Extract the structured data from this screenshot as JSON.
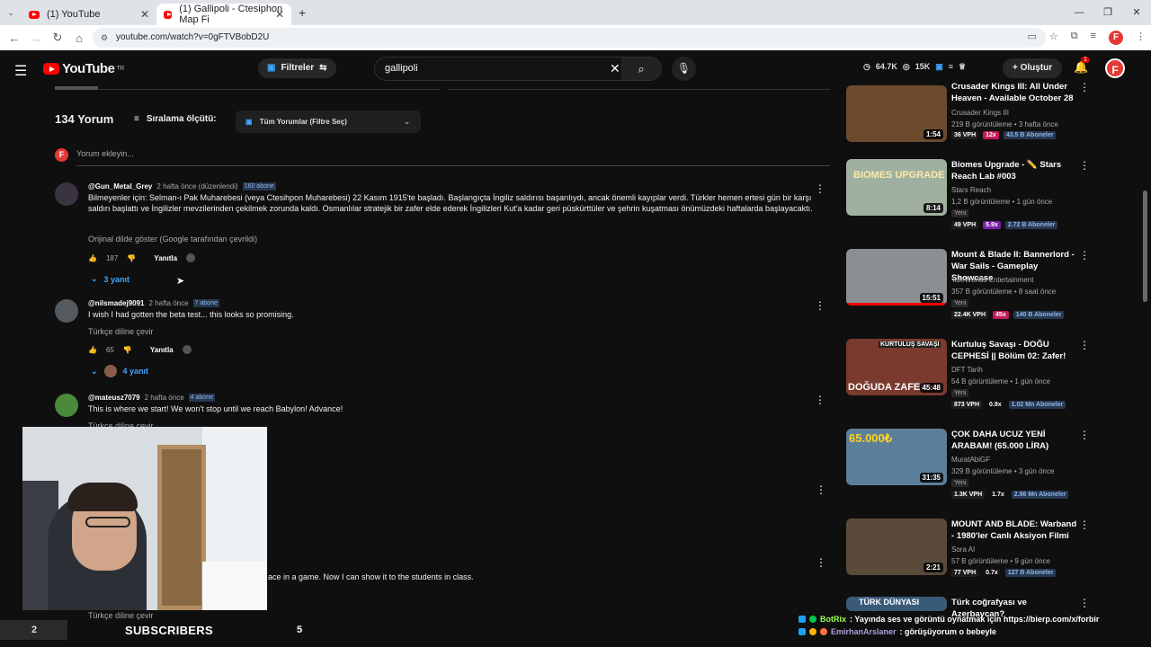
{
  "browser": {
    "tabs": [
      {
        "label": "(1) YouTube"
      },
      {
        "label": "(1) Gallipoli - Ctesiphon Map Fi"
      }
    ],
    "url": "youtube.com/watch?v=0gFTVBobD2U",
    "new_tab": "+",
    "window_controls": [
      "—",
      "❐",
      "✕"
    ]
  },
  "masthead": {
    "logo": "YouTube",
    "country": "TR",
    "filters_label": "Filtreler",
    "search_value": "gallipoli",
    "stats": [
      "64.7K",
      "15K"
    ],
    "create_label": "Oluştur",
    "notif_count": "1",
    "avatar_letter": "F"
  },
  "comments_header": {
    "count": "134 Yorum",
    "sort_label": "Sıralama ölçütü:",
    "filter_label": "Tüm Yorumlar (Filtre Seç)",
    "add_placeholder": "Yorum ekleyin..."
  },
  "comments": [
    {
      "user": "@Gun_Metal_Grey",
      "time": "2 hafta önce (düzenlendi)",
      "subs": "160 abone",
      "text": "Bilmeyenler için: Selman-ı Pak Muharebesi (veya Ctesihpon Muharebesi) 22 Kasım 1915'te başladı. Başlangıçta İngiliz saldırısı başarılıydı, ancak önemli kayıplar verdi. Türkler hemen ertesi gün bir karşı saldırı başlattı ve İngilizler mevzilerinden çekilmek zorunda kaldı. Osmanlılar stratejik bir zafer elde ederek İngilizleri Kut'a kadar geri püskürttüler ve şehrin kuşatması önümüzdeki haftalarda başlayacaktı.",
      "translate": "Orijinal dilde göster (Google tarafından çevrildi)",
      "likes": "187",
      "reply_label": "Yanıtla",
      "replies": "3 yanıt"
    },
    {
      "user": "@nilsmadej9091",
      "time": "2 hafta önce",
      "subs": "7 abone",
      "text": "I wish I had gotten the beta test... this looks so promising.",
      "translate": "Türkçe diline çevir",
      "likes": "65",
      "reply_label": "Yanıtla",
      "replies": "4 yanıt"
    },
    {
      "user": "@mateusz7079",
      "time": "2 hafta önce",
      "subs": "4 abone",
      "text": "This is where we start! We won't stop until we reach Babylon! Advance!",
      "translate": "Türkçe diline çevir"
    }
  ],
  "partial_comment": {
    "text": "ace in a game. Now I can show it to the students in class.",
    "translate": "Türkçe diline çevir"
  },
  "sidebar": [
    {
      "title": "Crusader Kings III: All Under Heaven - Available October 28",
      "channel": "Crusader Kings III",
      "meta": "219 B görüntüleme • 3 hafta önce",
      "duration": "1:54",
      "vph": "36 VPH",
      "mult": "12x",
      "subs": "43.5 B Aboneler",
      "thumb_color": "#6b4a2e",
      "mult_color": "#c2185b"
    },
    {
      "title": "Biomes Upgrade - ✏️ Stars Reach Lab #003",
      "channel": "Stars Reach",
      "meta": "1,2 B görüntüleme • 1 gün önce",
      "badge": "Yeni",
      "duration": "8:14",
      "vph": "49 VPH",
      "mult": "5.9x",
      "subs": "2.72 B Aboneler",
      "thumb_label": "BIOMES UPGRADE",
      "thumb_color": "#9fb0a0",
      "mult_color": "#7b1fa2"
    },
    {
      "title": "Mount & Blade II: Bannerlord - War Sails - Gameplay Showcase",
      "channel": "TaleWorlds Entertainment",
      "meta": "357 B görüntüleme • 8 saat önce",
      "badge": "Yeni",
      "duration": "15:51",
      "vph": "22.4K VPH",
      "mult": "45x",
      "subs": "140 B Aboneler",
      "thumb_color": "#8a8f93",
      "mult_color": "#c2185b",
      "progress": 1.0
    },
    {
      "title": "Kurtuluş Savaşı - DOĞU CEPHESİ || Bölüm 02: Zafer!",
      "channel": "DFT Tarih",
      "meta": "54 B görüntüleme • 1 gün önce",
      "badge": "Yeni",
      "duration": "45:48",
      "vph": "873 VPH",
      "mult": "0.9x",
      "subs": "1.02 Mn Aboneler",
      "thumb_label": "KURTULUŞ SAVAŞI",
      "thumb_label2": "DOĞUDA ZAFER",
      "thumb_color": "#7a3a2e",
      "mult_color": ""
    },
    {
      "title": "ÇOK DAHA UCUZ YENİ ARABAM! (65.000 LİRA)",
      "channel": "MuratAbiGF",
      "meta": "329 B görüntüleme • 3 gün önce",
      "badge": "Yeni",
      "duration": "31:35",
      "vph": "1.3K VPH",
      "mult": "1.7x",
      "subs": "2.86 Mn Aboneler",
      "thumb_label": "65.000₺",
      "thumb_color": "#5b7f9a",
      "mult_color": ""
    },
    {
      "title": "MOUNT AND BLADE: Warband - 1980'ler Canlı Aksiyon Filmi",
      "channel": "Sora AI",
      "meta": "57 B görüntüleme • 9 gün önce",
      "duration": "2:21",
      "vph": "77 VPH",
      "mult": "0.7x",
      "subs": "127 B Aboneler",
      "thumb_color": "#5a4a3a",
      "mult_color": ""
    },
    {
      "title": "Türk coğrafyası ve Azerbaycan?",
      "channel": "",
      "meta": "",
      "thumb_label": "TÜRK DÜNYASI",
      "thumb_color": "#3a5a7a"
    }
  ],
  "chat": [
    {
      "user": "BotRix",
      "text": ": Yayında ses ve görüntü oynatmak için https://bierp.com/x/forbir",
      "user_color": "#9cff57"
    },
    {
      "user": "EmirhanArslaner",
      "text": ": görüşüyorum o bebeyle",
      "user_color": "#b39ddb"
    }
  ],
  "overlay": {
    "left_num": "2",
    "label": "SUBSCRIBERS",
    "right_num": "5"
  }
}
